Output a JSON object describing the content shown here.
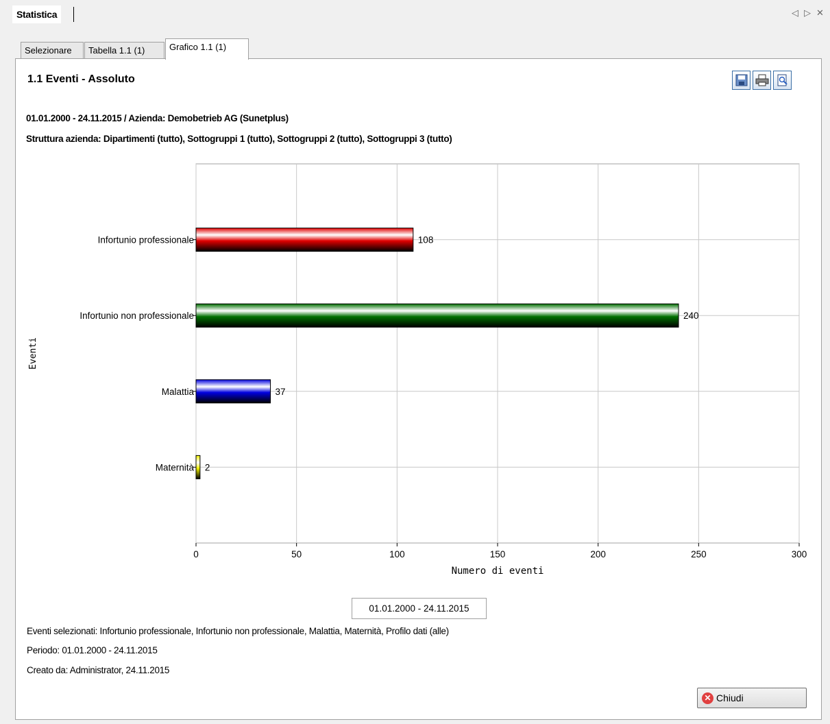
{
  "document_tab": {
    "label": "Statistica"
  },
  "window_controls": {
    "prev": "◁",
    "next": "▷",
    "close": "✕"
  },
  "tabs": [
    {
      "label": "Selezionare",
      "active": false
    },
    {
      "label": "Tabella 1.1 (1)",
      "active": false
    },
    {
      "label": "Grafico 1.1 (1)",
      "active": true
    }
  ],
  "report": {
    "title": "1.1 Eventi - Assoluto",
    "subtitle_1": "01.01.2000 - 24.11.2015 / Azienda: Demobetrieb AG (Sunetplus)",
    "subtitle_2": "Struttura azienda: Dipartimenti (tutto), Sottogruppi 1 (tutto), Sottogruppi 2 (tutto), Sottogruppi 3 (tutto)"
  },
  "toolbar": {
    "save_icon": "save-icon",
    "print_icon": "print-icon",
    "preview_icon": "preview-icon"
  },
  "chart_data": {
    "type": "bar",
    "orientation": "horizontal",
    "categories": [
      "Infortunio professionale",
      "Infortunio non professionale",
      "Malattia",
      "Maternità"
    ],
    "values": [
      108,
      240,
      37,
      2
    ],
    "colors": [
      "#e00000",
      "#007000",
      "#0000e0",
      "#f0f000"
    ],
    "xlabel": "Numero di eventi",
    "ylabel": "Eventi",
    "xlim": [
      0,
      300
    ],
    "xticks": [
      0,
      50,
      100,
      150,
      200,
      250,
      300
    ],
    "grid": true,
    "data_labels": true
  },
  "legend": {
    "label": "01.01.2000 - 24.11.2015"
  },
  "footer": {
    "events_selected": "Eventi selezionati: Infortunio professionale, Infortunio non professionale, Malattia, Maternità, Profilo dati (alle)",
    "period": "Periodo: 01.01.2000 - 24.11.2015",
    "created_by": "Creato da: Administrator, 24.11.2015"
  },
  "close_button": {
    "label": "Chiudi"
  }
}
